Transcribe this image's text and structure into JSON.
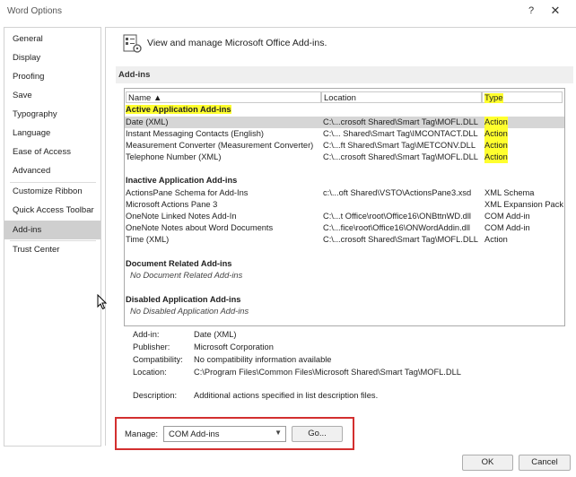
{
  "window": {
    "title": "Word Options",
    "help": "?",
    "close": "✕"
  },
  "sidebar": {
    "items": [
      {
        "label": "General",
        "selected": false
      },
      {
        "label": "Display",
        "selected": false
      },
      {
        "label": "Proofing",
        "selected": false
      },
      {
        "label": "Save",
        "selected": false
      },
      {
        "label": "Typography",
        "selected": false
      },
      {
        "label": "Language",
        "selected": false
      },
      {
        "label": "Ease of Access",
        "selected": false
      },
      {
        "label": "Advanced",
        "selected": false
      },
      {
        "label": "Customize Ribbon",
        "selected": false
      },
      {
        "label": "Quick Access Toolbar",
        "selected": false
      },
      {
        "label": "Add-ins",
        "selected": true
      },
      {
        "label": "Trust Center",
        "selected": false
      }
    ]
  },
  "header": {
    "text": "View and manage Microsoft Office Add-ins."
  },
  "section": {
    "title": "Add-ins"
  },
  "list": {
    "columns": {
      "name": "Name ▲",
      "location": "Location",
      "type": "Type"
    },
    "groups": {
      "active": {
        "title": "Active Application Add-ins",
        "rows": [
          {
            "name": "Date (XML)",
            "location": "C:\\...crosoft Shared\\Smart Tag\\MOFL.DLL",
            "type": "Action"
          },
          {
            "name": "Instant Messaging Contacts (English)",
            "location": "C:\\... Shared\\Smart Tag\\IMCONTACT.DLL",
            "type": "Action"
          },
          {
            "name": "Measurement Converter (Measurement Converter)",
            "location": "C:\\...ft Shared\\Smart Tag\\METCONV.DLL",
            "type": "Action"
          },
          {
            "name": "Telephone Number (XML)",
            "location": "C:\\...crosoft Shared\\Smart Tag\\MOFL.DLL",
            "type": "Action"
          }
        ]
      },
      "inactive": {
        "title": "Inactive Application Add-ins",
        "rows": [
          {
            "name": "ActionsPane Schema for Add-Ins",
            "location": "c:\\...oft Shared\\VSTO\\ActionsPane3.xsd",
            "type": "XML Schema"
          },
          {
            "name": "Microsoft Actions Pane 3",
            "location": "",
            "type": "XML Expansion Pack"
          },
          {
            "name": "OneNote Linked Notes Add-In",
            "location": "C:\\...t Office\\root\\Office16\\ONBttnWD.dll",
            "type": "COM Add-in"
          },
          {
            "name": "OneNote Notes about Word Documents",
            "location": "C:\\...fice\\root\\Office16\\ONWordAddin.dll",
            "type": "COM Add-in"
          },
          {
            "name": "Time (XML)",
            "location": "C:\\...crosoft Shared\\Smart Tag\\MOFL.DLL",
            "type": "Action"
          }
        ]
      },
      "document": {
        "title": "Document Related Add-ins",
        "empty": "No Document Related Add-ins"
      },
      "disabled": {
        "title": "Disabled Application Add-ins",
        "empty": "No Disabled Application Add-ins"
      }
    }
  },
  "details": {
    "addin": {
      "label": "Add-in:",
      "value": "Date (XML)"
    },
    "publisher": {
      "label": "Publisher:",
      "value": "Microsoft Corporation"
    },
    "compat": {
      "label": "Compatibility:",
      "value": "No compatibility information available"
    },
    "location": {
      "label": "Location:",
      "value": "C:\\Program Files\\Common Files\\Microsoft Shared\\Smart Tag\\MOFL.DLL"
    },
    "description": {
      "label": "Description:",
      "value": "Additional actions specified in list description files."
    }
  },
  "manage": {
    "label": "Manage:",
    "selected": "COM Add-ins",
    "go": "Go..."
  },
  "footer": {
    "ok": "OK",
    "cancel": "Cancel"
  },
  "colors": {
    "highlight": "#ffff2e",
    "selected_row": "#d6d6d6",
    "red_box": "#d32f2f"
  }
}
